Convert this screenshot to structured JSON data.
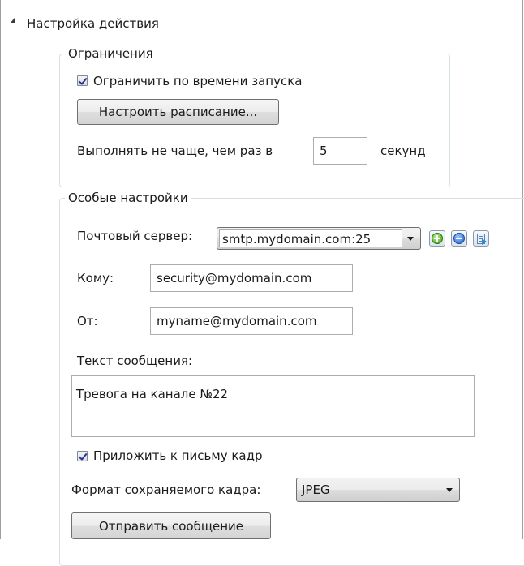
{
  "section": {
    "title": "Настройка действия"
  },
  "limits": {
    "legend": "Ограничения",
    "limit_by_time_label": "Ограничить по времени запуска",
    "limit_by_time_checked": true,
    "schedule_button": "Настроить расписание...",
    "frequency_prefix": "Выполнять не чаще, чем раз в",
    "frequency_value": "5",
    "frequency_suffix": "секунд"
  },
  "special": {
    "legend": "Особые настройки",
    "mail_server_label": "Почтовый сервер:",
    "mail_server_value": "smtp.mydomain.com:25",
    "to_label": "Кому:",
    "to_value": "security@mydomain.com",
    "from_label": "От:",
    "from_value": "myname@mydomain.com",
    "message_label": "Текст сообщения:",
    "message_value": "Тревога на канале №22",
    "attach_frame_label": "Приложить к письму кадр",
    "attach_frame_checked": true,
    "frame_format_label": "Формат сохраняемого кадра:",
    "frame_format_value": "JPEG",
    "send_button": "Отправить сообщение"
  },
  "icons": {
    "add_server": "plus-circle-icon",
    "remove_server": "minus-circle-icon",
    "edit_server": "document-arrow-icon"
  },
  "colors": {
    "group_border": "#d5dfe5",
    "checkmark": "#22349a",
    "add_green": "#3c9a18",
    "remove_blue": "#1c5fc4"
  }
}
